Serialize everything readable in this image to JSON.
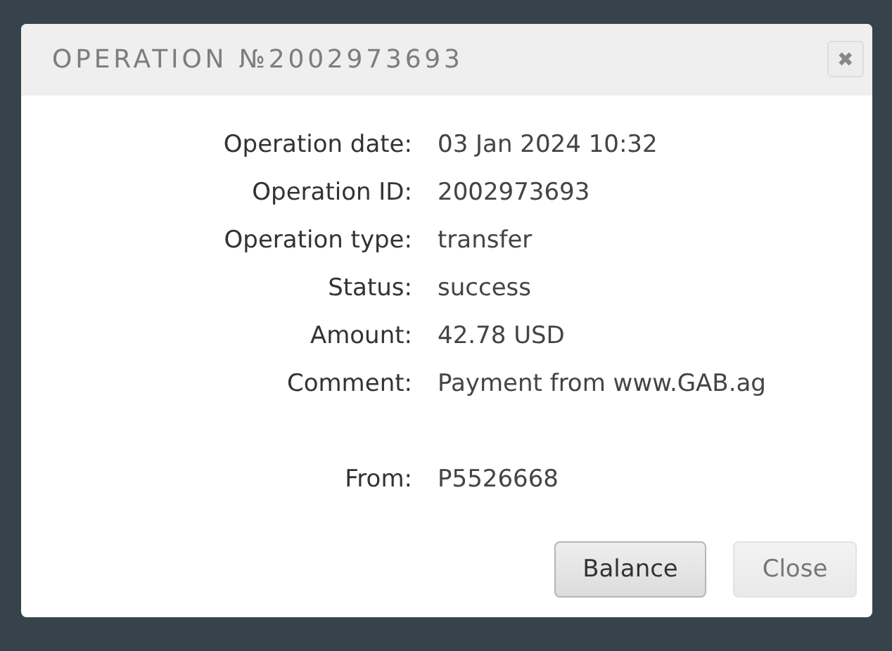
{
  "dialog": {
    "title": "OPERATION №2002973693",
    "close_icon": "✖"
  },
  "fields": [
    {
      "label": "Operation date:",
      "value": "03 Jan 2024 10:32"
    },
    {
      "label": "Operation ID:",
      "value": "2002973693"
    },
    {
      "label": "Operation type:",
      "value": "transfer"
    },
    {
      "label": "Status:",
      "value": "success"
    },
    {
      "label": "Amount:",
      "value": "42.78 USD"
    },
    {
      "label": "Comment:",
      "value": "Payment from www.GAB.ag"
    }
  ],
  "source_fields": [
    {
      "label": "From:",
      "value": "P5526668"
    }
  ],
  "buttons": [
    {
      "label": "Balance",
      "kind": "primary"
    },
    {
      "label": "Close",
      "kind": "secondary"
    }
  ]
}
